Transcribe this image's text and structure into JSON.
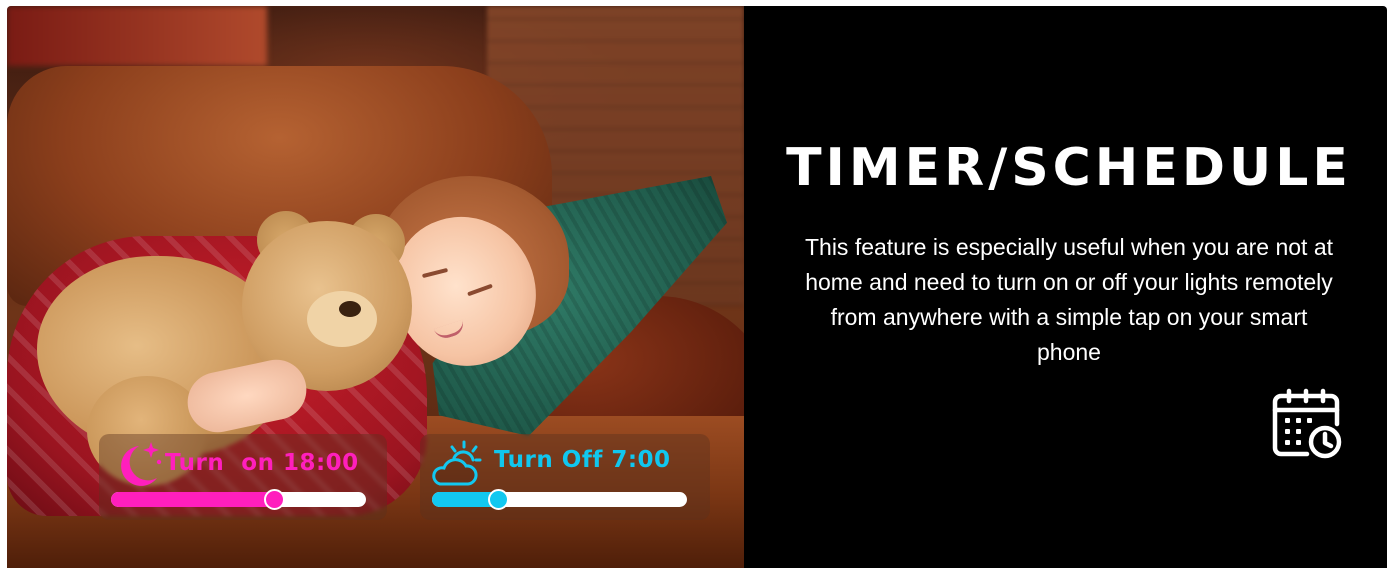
{
  "feature": {
    "title": "TIMER/SCHEDULE",
    "description": "This feature is especially useful when you are not at home and need to turn on or off your lights remotely from anywhere with a simple tap on your smart phone",
    "icon": "calendar-clock-icon"
  },
  "controls": {
    "turn_on": {
      "label": "Turn  on 18:00",
      "icon": "moon-stars-icon",
      "color": "#ff1fbd",
      "slider_fraction": 0.64
    },
    "turn_off": {
      "label": "Turn Off 7:00",
      "icon": "sun-cloud-icon",
      "color": "#12c8f0",
      "slider_fraction": 0.26
    }
  },
  "colors": {
    "panel_background": "#000000",
    "text": "#ffffff"
  }
}
